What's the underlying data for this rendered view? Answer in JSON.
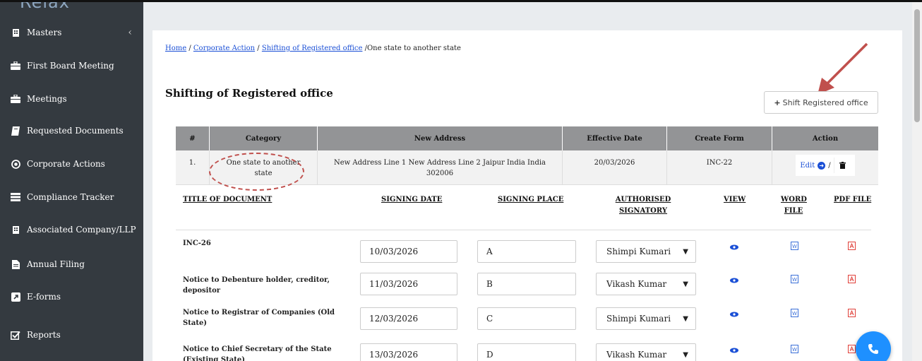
{
  "sidebar": {
    "logo": "Relax",
    "items": [
      {
        "label": "Masters",
        "icon": "building-icon"
      },
      {
        "label": "First Board Meeting",
        "icon": "briefcase-icon"
      },
      {
        "label": "Meetings",
        "icon": "briefcase-icon"
      },
      {
        "label": "Requested Documents",
        "icon": "book-icon"
      },
      {
        "label": "Corporate Actions",
        "icon": "target-icon"
      },
      {
        "label": "Compliance Tracker",
        "icon": "list-icon"
      },
      {
        "label": "Associated Company/LLP",
        "icon": "building-icon"
      },
      {
        "label": "Annual Filing",
        "icon": "file-icon"
      },
      {
        "label": "E-forms",
        "icon": "external-link-icon"
      },
      {
        "label": "Reports",
        "icon": "checkbox-icon"
      }
    ]
  },
  "breadcrumb": {
    "home": "Home",
    "sep1": " / ",
    "corporate_action": "Corporate Action",
    "sep2": " / ",
    "shifting": "Shifting of Registered office",
    "current": " /One state to another state"
  },
  "page": {
    "title": "Shifting of Registered office",
    "shift_button": "Shift Registered office"
  },
  "table": {
    "headers": [
      "#",
      "Category",
      "New Address",
      "Effective Date",
      "Create Form",
      "Action"
    ],
    "row": {
      "num": "1.",
      "category": "One state to another state",
      "address": "New Address Line 1 New Address Line 2 Jaipur India India 302006",
      "effective_date": "20/03/2026",
      "form": "INC-22",
      "edit": "Edit"
    }
  },
  "documents": {
    "headers": {
      "title": "TITLE OF DOCUMENT",
      "date": "SIGNING DATE",
      "place": "SIGNING PLACE",
      "signatory_1": "AUTHORISED",
      "signatory_2": "SIGNATORY",
      "view": "VIEW",
      "word_1": "WORD",
      "word_2": "FILE",
      "pdf": "PDF FILE"
    },
    "rows": [
      {
        "title": "INC-26",
        "date": "10/03/2026",
        "place": "A",
        "signatory": "Shimpi Kumari"
      },
      {
        "title": "Notice to Debenture holder, creditor, depositor",
        "date": "11/03/2026",
        "place": "B",
        "signatory": "Vikash Kumar"
      },
      {
        "title": "Notice to Registrar of Companies (Old State)",
        "date": "12/03/2026",
        "place": "C",
        "signatory": "Shimpi Kumari"
      },
      {
        "title": "Notice to Chief Secretary of the State (Existing State)",
        "date": "13/03/2026",
        "place": "D",
        "signatory": "Vikash Kumar"
      }
    ]
  },
  "colors": {
    "sidebar_bg": "#343a40",
    "link": "#1a4fd6",
    "category_text": "#e0403a",
    "annotation": "#c0504d",
    "fab": "#1e90ff"
  }
}
